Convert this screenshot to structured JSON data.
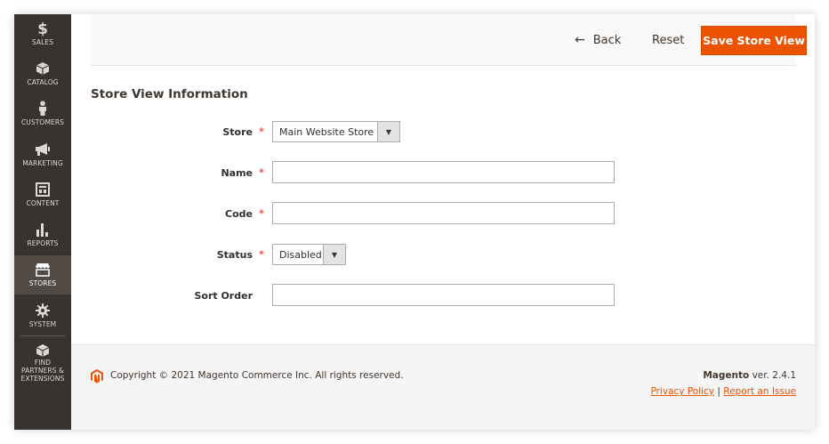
{
  "sidebar": {
    "items": [
      {
        "label": "SALES",
        "icon": "dollar-icon"
      },
      {
        "label": "CATALOG",
        "icon": "cube-icon"
      },
      {
        "label": "CUSTOMERS",
        "icon": "person-icon"
      },
      {
        "label": "MARKETING",
        "icon": "megaphone-icon"
      },
      {
        "label": "CONTENT",
        "icon": "layout-icon"
      },
      {
        "label": "REPORTS",
        "icon": "bar-chart-icon"
      },
      {
        "label": "STORES",
        "icon": "storefront-icon",
        "active": true
      },
      {
        "label": "SYSTEM",
        "icon": "gear-icon"
      },
      {
        "label": "FIND PARTNERS & EXTENSIONS",
        "icon": "box-icon"
      }
    ]
  },
  "actions": {
    "back_label": "Back",
    "reset_label": "Reset",
    "save_label": "Save Store View"
  },
  "section": {
    "title": "Store View Information"
  },
  "form": {
    "store": {
      "label": "Store",
      "required": true,
      "value": "Main Website Store"
    },
    "name": {
      "label": "Name",
      "required": true,
      "value": ""
    },
    "code": {
      "label": "Code",
      "required": true,
      "value": ""
    },
    "status": {
      "label": "Status",
      "required": true,
      "value": "Disabled"
    },
    "sort_order": {
      "label": "Sort Order",
      "required": false,
      "value": ""
    },
    "required_marker": "*"
  },
  "footer": {
    "copyright": "Copyright © 2021 Magento Commerce Inc. All rights reserved.",
    "brand": "Magento",
    "version": "ver. 2.4.1",
    "privacy_link": "Privacy Policy",
    "separator": "|",
    "report_link": "Report an Issue"
  },
  "colors": {
    "accent": "#eb5202",
    "sidebar_bg": "#373330",
    "sidebar_active": "#514943",
    "required": "#e22626"
  }
}
